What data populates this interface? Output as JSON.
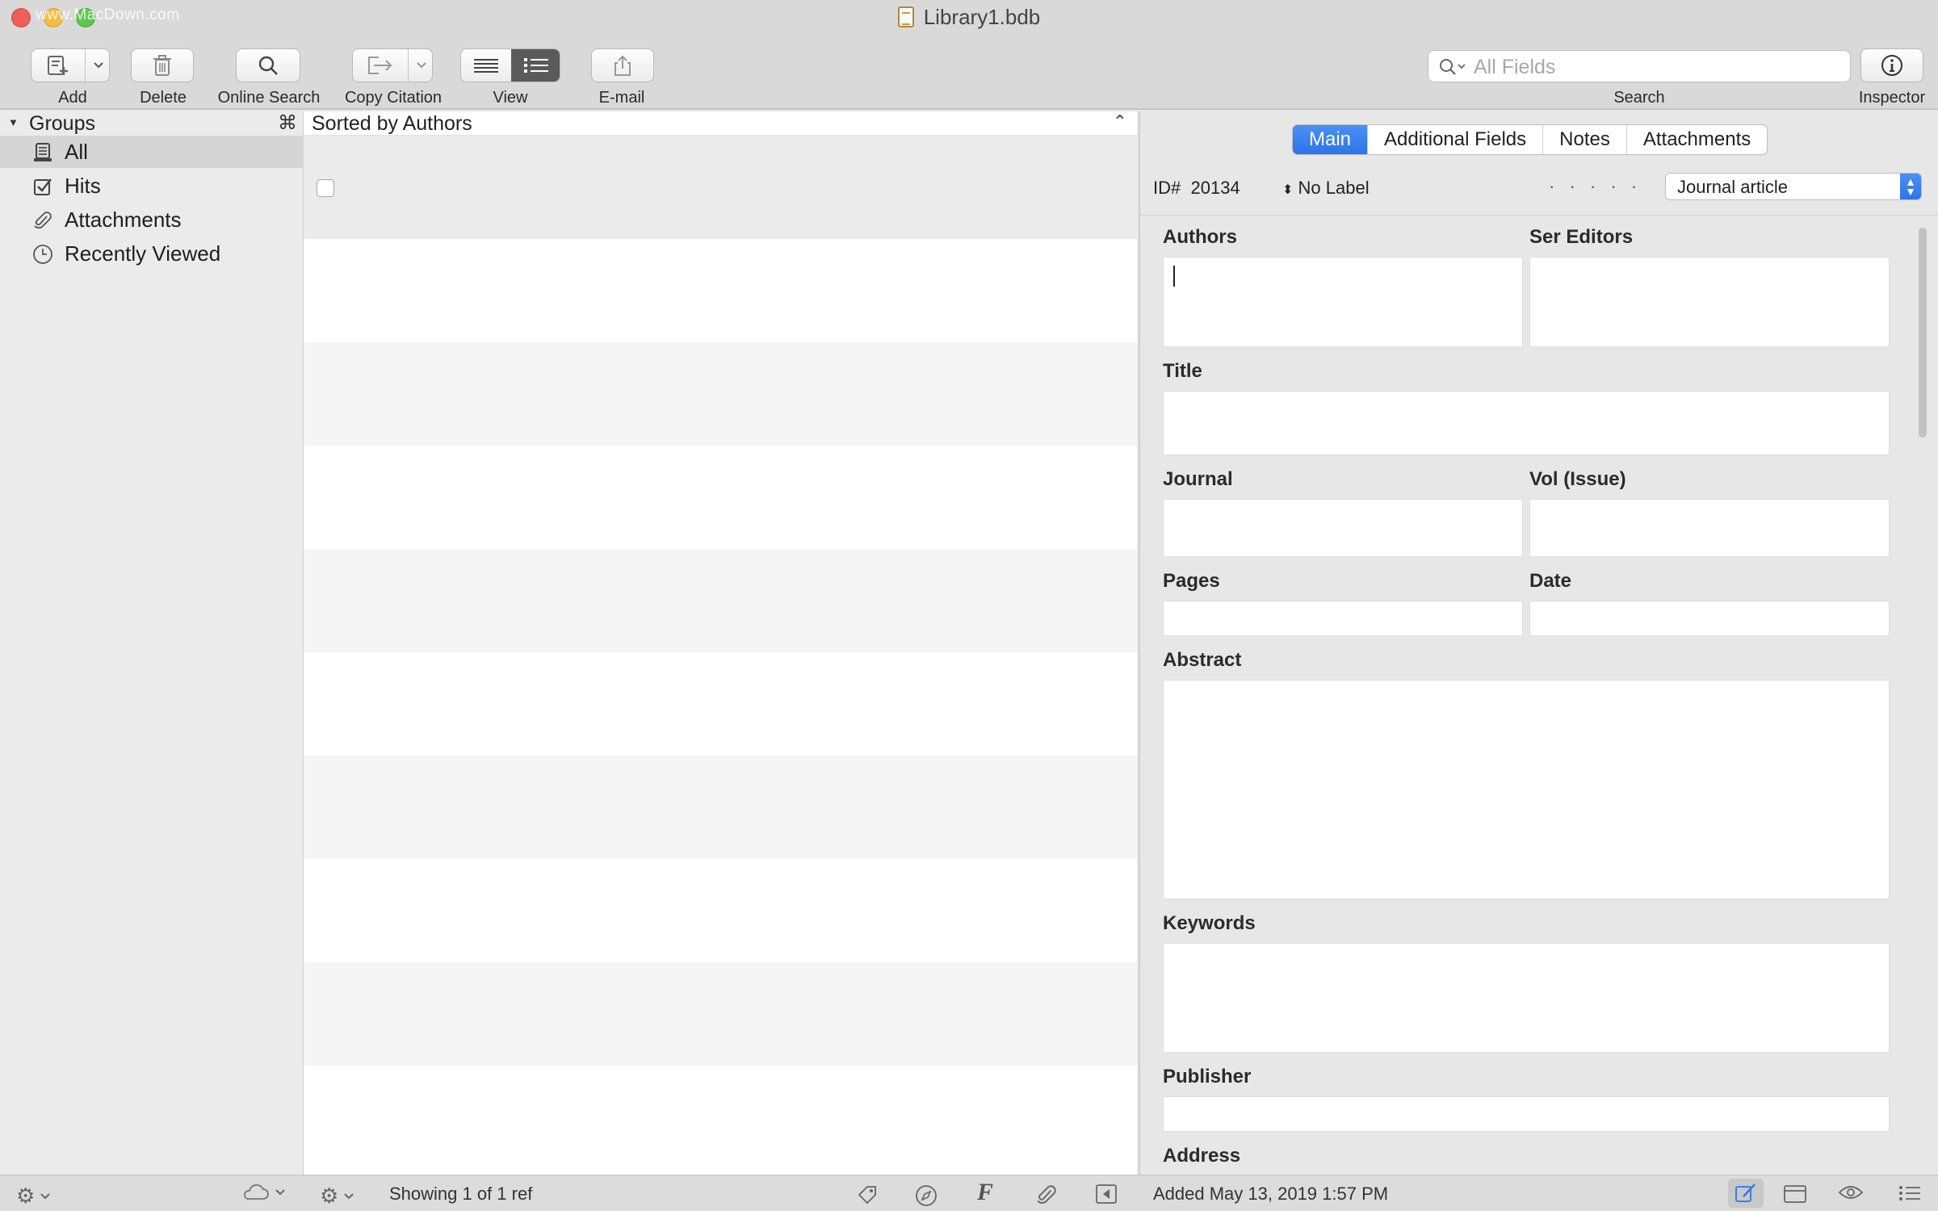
{
  "window": {
    "title": "Library1.bdb",
    "watermark": "www.MacDown.com"
  },
  "toolbar": {
    "add_label": "Add",
    "delete_label": "Delete",
    "online_search_label": "Online Search",
    "copy_citation_label": "Copy Citation",
    "view_label": "View",
    "email_label": "E-mail",
    "search_label": "Search",
    "search_placeholder": "All Fields",
    "inspector_label": "Inspector"
  },
  "sidebar": {
    "header": "Groups",
    "items": [
      {
        "label": "All",
        "icon": "library-icon",
        "selected": true
      },
      {
        "label": "Hits",
        "icon": "checkbox-icon"
      },
      {
        "label": "Attachments",
        "icon": "paperclip-icon"
      },
      {
        "label": "Recently Viewed",
        "icon": "clock-icon"
      }
    ]
  },
  "list": {
    "cmd_symbol": "⌘",
    "sort_label": "Sorted by Authors",
    "caret": "⌃"
  },
  "inspector": {
    "tabs": [
      {
        "label": "Main",
        "active": true
      },
      {
        "label": "Additional Fields"
      },
      {
        "label": "Notes"
      },
      {
        "label": "Attachments"
      }
    ],
    "id_prefix": "ID#",
    "id_value": "20134",
    "label_value": "No Label",
    "rating_dots": "· · · · ·",
    "ref_type": "Journal article",
    "fields": {
      "authors": "Authors",
      "ser_editors": "Ser Editors",
      "title": "Title",
      "journal": "Journal",
      "vol_issue": "Vol (Issue)",
      "pages": "Pages",
      "date": "Date",
      "abstract": "Abstract",
      "keywords": "Keywords",
      "publisher": "Publisher",
      "address": "Address"
    }
  },
  "status": {
    "showing": "Showing 1 of 1 ref",
    "added": "Added May 13, 2019 1:57 PM"
  },
  "colors": {
    "accent": "#2f74e8",
    "sidebar_bg": "#ebebeb",
    "toolbar_bg": "#d9d9d9"
  }
}
